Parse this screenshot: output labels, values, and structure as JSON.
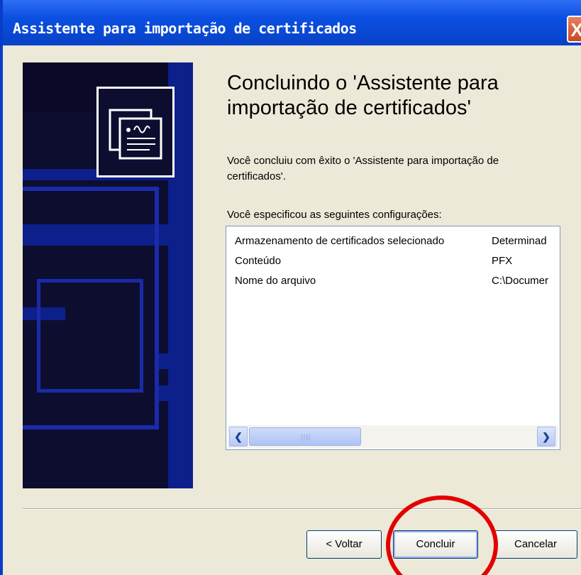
{
  "window": {
    "title": "Assistente para importação de certificados",
    "close_glyph": "X"
  },
  "main": {
    "heading": "Concluindo o 'Assistente para importação de certificados'",
    "description": "Você concluiu com êxito o 'Assistente para importação de certificados'.",
    "settings_label": "Você especificou as seguintes configurações:"
  },
  "settings_list": [
    {
      "key": "Armazenamento de certificados selecionado",
      "value": "Determinad"
    },
    {
      "key": "Conteúdo",
      "value": "PFX"
    },
    {
      "key": "Nome do arquivo",
      "value": "C:\\Documer"
    }
  ],
  "buttons": {
    "back": "< Voltar",
    "finish": "Concluir",
    "cancel": "Cancelar"
  },
  "icons": [
    "close-icon",
    "certificate-icon",
    "scroll-left-icon",
    "scroll-right-icon"
  ],
  "colors": {
    "titlebar": "#0b4fe0",
    "banner": "#0d0d30",
    "highlight": "#e20000",
    "dialog_bg": "#ece9d8"
  }
}
